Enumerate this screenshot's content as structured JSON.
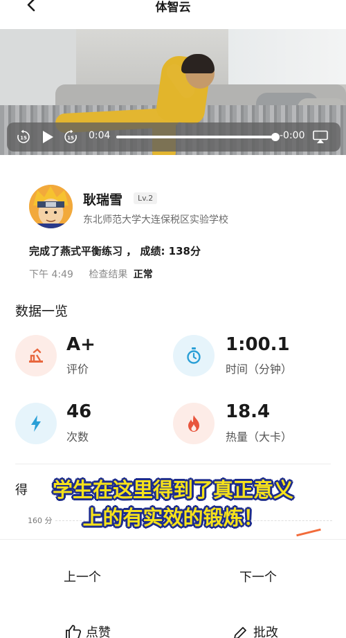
{
  "header": {
    "title": "体智云"
  },
  "video": {
    "current_time": "0:04",
    "remaining_time": "-0:00",
    "progress": 0.99,
    "skip_back_label": "15",
    "skip_forward_label": "15"
  },
  "profile": {
    "name": "耿瑞雪",
    "level": "Lv.2",
    "school": "东北师范大学大连保税区实验学校"
  },
  "activity": {
    "result": "完成了燕式平衡练习 ， 成绩: 138分",
    "time": "下午 4:49",
    "check_label": "检查结果",
    "check_status": "正常"
  },
  "overview": {
    "title": "数据一览",
    "stats": [
      {
        "value": "A+",
        "label": "评价",
        "icon": "rating-icon",
        "color": "#e8663d",
        "bg": "#fdece7"
      },
      {
        "value": "1:00.1",
        "label": "时间（分钟）",
        "icon": "stopwatch-icon",
        "color": "#2a9fd6",
        "bg": "#e6f4fb"
      },
      {
        "value": "46",
        "label": "次数",
        "icon": "lightning-icon",
        "color": "#2a9fd6",
        "bg": "#e6f4fb"
      },
      {
        "value": "18.4",
        "label": "热量（大卡）",
        "icon": "flame-icon",
        "color": "#e8553d",
        "bg": "#fdece7"
      }
    ]
  },
  "score_chart": {
    "title_visible": "得",
    "y_tick": "160 分"
  },
  "caption": {
    "line1": "学生在这里得到了真正意义",
    "line2": "上的有实效的锻炼！"
  },
  "bottom": {
    "prev_label": "上一个",
    "next_label": "下一个",
    "like_label": "点赞",
    "review_label": "批改"
  }
}
